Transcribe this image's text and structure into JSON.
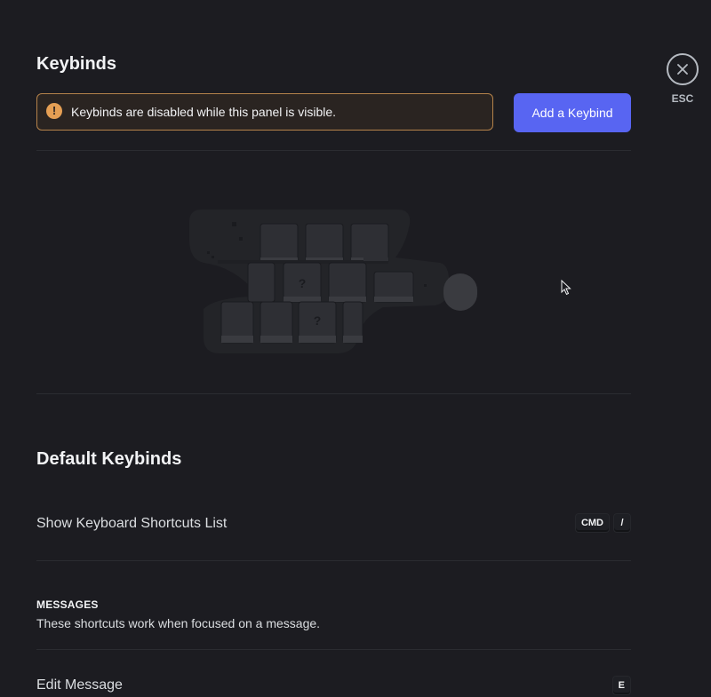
{
  "panel": {
    "title": "Keybinds",
    "notice": "Keybinds are disabled while this panel is visible.",
    "add_button": "Add a Keybind",
    "illustration_icon": "empty-keyboard-illustration"
  },
  "close": {
    "label": "ESC",
    "icon": "close-icon"
  },
  "defaults": {
    "title": "Default Keybinds",
    "shortcuts_row": {
      "label": "Show Keyboard Shortcuts List",
      "keys": [
        "CMD",
        "/"
      ]
    }
  },
  "messages": {
    "heading": "MESSAGES",
    "description": "These shortcuts work when focused on a message.",
    "edit_row": {
      "label": "Edit Message",
      "keys": [
        "E"
      ]
    }
  },
  "colors": {
    "background": "#1c1c21",
    "accent": "#5865f2",
    "warning": "#e59f54"
  }
}
